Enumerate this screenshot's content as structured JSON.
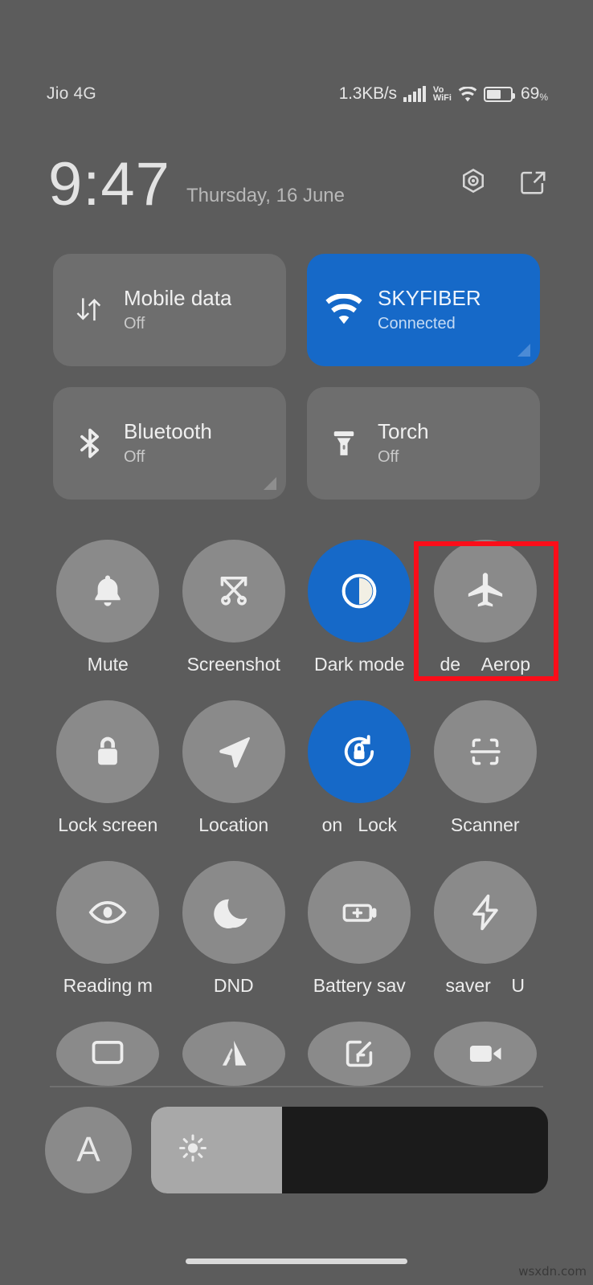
{
  "status_bar": {
    "carrier": "Jio 4G",
    "network_speed": "1.3KB/s",
    "signal_icon": "signal-bars-icon",
    "volte_line1": "Vo",
    "volte_line2": "WiFi",
    "wifi_icon": "wifi-icon",
    "battery_icon": "battery-icon",
    "battery_percent": "69",
    "battery_percent_symbol": "%"
  },
  "header": {
    "clock": "9:47",
    "date": "Thursday, 16 June",
    "settings_icon": "settings-gear-icon",
    "edit_icon": "edit-tiles-icon"
  },
  "big_tiles": [
    {
      "name": "mobile-data",
      "icon": "mobile-data-icon",
      "title": "Mobile data",
      "subtitle": "Off",
      "state": "off",
      "has_corner_expand": false
    },
    {
      "name": "wifi",
      "icon": "wifi-icon",
      "title": "SKYFIBER",
      "subtitle": "Connected",
      "state": "on",
      "has_corner_expand": true
    },
    {
      "name": "bluetooth",
      "icon": "bluetooth-icon",
      "title": "Bluetooth",
      "subtitle": "Off",
      "state": "off",
      "has_corner_expand": true
    },
    {
      "name": "torch",
      "icon": "torch-icon",
      "title": "Torch",
      "subtitle": "Off",
      "state": "off",
      "has_corner_expand": false
    }
  ],
  "toggles": {
    "row1": [
      {
        "name": "mute",
        "icon": "bell-icon",
        "label": "Mute",
        "state": "off"
      },
      {
        "name": "screenshot",
        "icon": "screenshot-icon",
        "label": "Screenshot",
        "state": "off"
      },
      {
        "name": "dark-mode",
        "icon": "contrast-icon",
        "label": "Dark mode",
        "state": "on"
      },
      {
        "name": "aeroplane-mode",
        "icon": "airplane-icon",
        "label": "Aerop",
        "label_left_fragment": "de",
        "state": "off"
      }
    ],
    "row2": [
      {
        "name": "lock-screen",
        "icon": "lock-icon",
        "label": "Lock screen",
        "state": "off"
      },
      {
        "name": "location",
        "icon": "location-arrow-icon",
        "label": "Location",
        "state": "off"
      },
      {
        "name": "rotation-lock",
        "icon": "rotation-lock-icon",
        "label": "Lock",
        "label_left_fragment": "on",
        "state": "on"
      },
      {
        "name": "scanner",
        "icon": "scanner-icon",
        "label": "Scanner",
        "state": "off"
      }
    ],
    "row3": [
      {
        "name": "reading-mode",
        "icon": "eye-icon",
        "label": "Reading m",
        "state": "off"
      },
      {
        "name": "dnd",
        "icon": "moon-icon",
        "label": "DND",
        "state": "off"
      },
      {
        "name": "battery-saver",
        "icon": "battery-plus-icon",
        "label": "Battery sav",
        "state": "off"
      },
      {
        "name": "ultra-battery-saver",
        "icon": "lightning-icon",
        "label": "saver",
        "label_right_fragment": "U",
        "state": "off"
      }
    ],
    "row4_clipped": [
      {
        "name": "cast",
        "icon": "cast-screen-icon",
        "label": "",
        "state": "off"
      },
      {
        "name": "second-space",
        "icon": "second-space-icon",
        "label": "",
        "state": "off"
      },
      {
        "name": "screen-recorder",
        "icon": "screen-record-icon",
        "label": "",
        "state": "off"
      },
      {
        "name": "video-toolbox",
        "icon": "video-camera-icon",
        "label": "",
        "state": "off"
      }
    ]
  },
  "brightness": {
    "auto_label": "A",
    "auto_icon": "auto-brightness-icon",
    "slider_icon": "sun-icon",
    "slider_fill_percent": 33
  },
  "highlight": {
    "name": "aeroplane-mode-highlight",
    "color": "#fb0d19"
  },
  "watermark": "wsxdn.com",
  "colors": {
    "background": "#5c5c5c",
    "tile_off": "#6e6e6e",
    "bubble_off": "#8a8a8a",
    "accent_blue": "#1669c8",
    "slider_track": "#1b1b1b",
    "slider_fill": "#a8a8a8",
    "highlight_red": "#fb0d19"
  }
}
